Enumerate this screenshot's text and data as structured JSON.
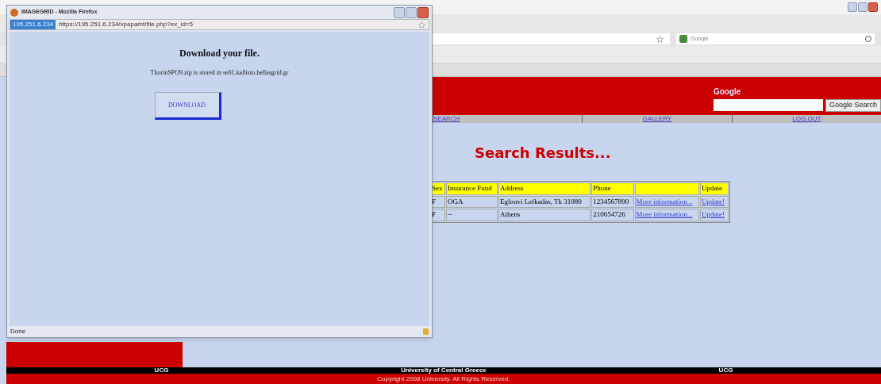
{
  "popup": {
    "title": "IMAGEGRID - Mozilla Firefox",
    "site_chip": "195.251.6.234",
    "url": "https://195.251.6.234/vpapamt/file.php?ex_id=5",
    "heading": "Download your file.",
    "message": "ThorinSPO9.zip is stored in se01.kallisto.hellasgrid.gr",
    "button": "DOWNLOAD",
    "status": "Done"
  },
  "browser": {
    "search_placeholder": "Google"
  },
  "header": {
    "logo": "Google",
    "search_button": "Google Search"
  },
  "nav": [
    "SEARCH",
    "GALLERY",
    "LOG OUT"
  ],
  "content": {
    "heading": "Search Results...",
    "table": {
      "columns": [
        "Sex",
        "Insurance Fund",
        "Address",
        "Phone",
        "",
        "Update"
      ],
      "rows": [
        [
          "F",
          "OGA",
          "Eglouvi Lefkadas, Tk 31080",
          "1234567890",
          "More information...",
          "Update!"
        ],
        [
          "F",
          "--",
          "Athens",
          "210654726",
          "More information...",
          "Update!"
        ]
      ]
    }
  },
  "footer": {
    "items": [
      "UCG",
      "University of Central Greece",
      "UCG"
    ],
    "copyright": "Copyright 2008 University. All Rights Reserved."
  }
}
